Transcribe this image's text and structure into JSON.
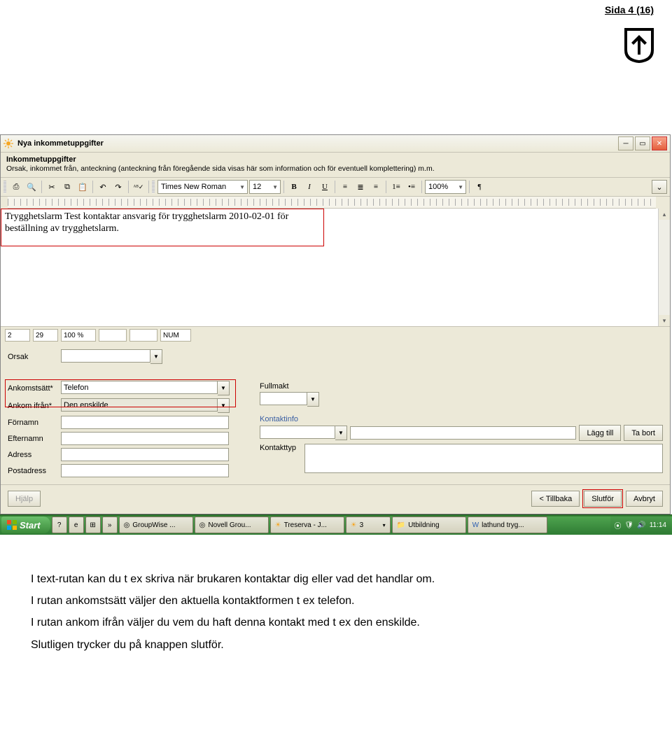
{
  "page_number": "Sida 4 (16)",
  "window": {
    "title": "Nya inkommetuppgifter",
    "section_title": "Inkommetuppgifter",
    "section_desc": "Orsak, inkommet från, anteckning (anteckning från föregående sida visas här som information och för eventuell komplettering) m.m."
  },
  "toolbar": {
    "font": "Times New Roman",
    "font_size": "12",
    "zoom": "100%",
    "btns": {
      "bold": "B",
      "italic": "I",
      "underline": "U",
      "pilcrow": "¶"
    }
  },
  "editor": {
    "line1": "Trygghetslarm Test kontaktar ansvarig för trygghetslarm 2010-02-01 för",
    "line2": "beställning av trygghetslarm."
  },
  "status": {
    "v1": "2",
    "v2": "29",
    "v3": "100 %",
    "v4": "",
    "v5": "NUM"
  },
  "form": {
    "orsak_label": "Orsak",
    "ankomstsatt_label": "Ankomstsätt*",
    "ankomstsatt_value": "Telefon",
    "ankom_ifran_label": "Ankom ifrån*",
    "ankom_ifran_value": "Den enskilde",
    "fornamn_label": "Förnamn",
    "efternamn_label": "Efternamn",
    "adress_label": "Adress",
    "postadress_label": "Postadress",
    "fullmakt_label": "Fullmakt",
    "kontaktinfo_label": "Kontaktinfo",
    "kontakttyp_label": "Kontakttyp",
    "lagg_till": "Lägg till",
    "ta_bort": "Ta bort"
  },
  "footer": {
    "hjalp": "Hjälp",
    "tillbaka": "< Tillbaka",
    "slutfor": "Slutför",
    "avbryt": "Avbryt"
  },
  "taskbar": {
    "start": "Start",
    "items": [
      "GroupWise ...",
      "Novell Grou...",
      "Treserva - J...",
      "3",
      "Utbildning",
      "lathund tryg..."
    ],
    "clock": "11:14"
  },
  "body": {
    "p1": "I text-rutan kan du t ex skriva när brukaren kontaktar dig eller vad det handlar om.",
    "p2": "I rutan ankomstsätt väljer den aktuella kontaktformen t ex telefon.",
    "p3": "I rutan ankom ifrån väljer du vem du haft denna kontakt med t ex den enskilde.",
    "p4": "Slutligen trycker du på knappen slutför."
  }
}
